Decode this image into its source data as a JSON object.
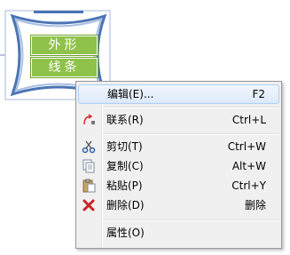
{
  "shape": {
    "labels": [
      "外形",
      "线条"
    ]
  },
  "menu": {
    "items": [
      {
        "label": "编辑(E)...",
        "shortcut": "F2",
        "icon": "none",
        "highlighted": true
      },
      {
        "label": "联系(R)",
        "shortcut": "Ctrl+L",
        "icon": "relation-icon"
      },
      {
        "label": "剪切(T)",
        "shortcut": "Ctrl+W",
        "icon": "scissors-icon"
      },
      {
        "label": "复制(C)",
        "shortcut": "Alt+W",
        "icon": "copy-icon"
      },
      {
        "label": "粘贴(P)",
        "shortcut": "Ctrl+Y",
        "icon": "paste-icon"
      },
      {
        "label": "删除(D)",
        "shortcut": "删除",
        "icon": "delete-icon"
      },
      {
        "label": "属性(O)",
        "shortcut": "",
        "icon": "none"
      }
    ]
  },
  "colors": {
    "accent_blue": "#4a74b5",
    "label_green": "#8fc24a",
    "delete_red": "#d02020"
  }
}
